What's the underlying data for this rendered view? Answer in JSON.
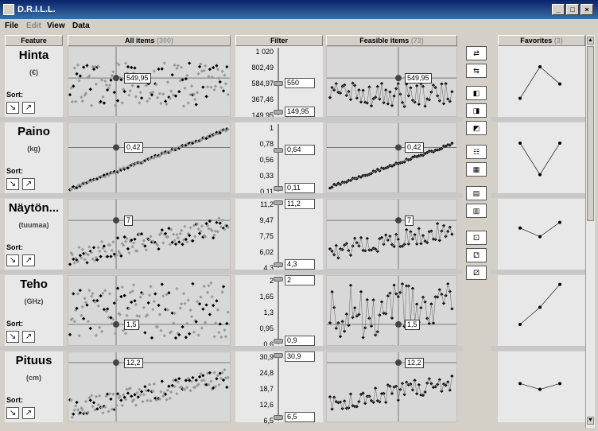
{
  "window": {
    "title": "D.R.I.L.L."
  },
  "menu": [
    "File",
    "Edit",
    "View",
    "Data"
  ],
  "headers": {
    "feature": "Feature",
    "all_items": "All items",
    "all_count": "(300)",
    "filter": "Filter",
    "feasible": "Feasible items",
    "feasible_count": "(73)",
    "favorites": "Favorites",
    "favorites_count": "(3)"
  },
  "sort_label": "Sort:",
  "features": [
    {
      "name": "Hinta",
      "unit": "(€)",
      "ticks": [
        "1 020",
        "802,49",
        "584,97",
        "367,46",
        "149,95"
      ],
      "upper": "550",
      "lower": "149,95",
      "value": "549,95",
      "fav": [
        0.2,
        0.75,
        0.45
      ]
    },
    {
      "name": "Paino",
      "unit": "(kg)",
      "ticks": [
        "1",
        "0,78",
        "0,56",
        "0,33",
        "0,11"
      ],
      "upper": "0,64",
      "lower": "0,11",
      "value": "0,42",
      "fav": [
        0.75,
        0.2,
        0.75
      ]
    },
    {
      "name": "Näytön...",
      "unit": "(tuumaa)",
      "ticks": [
        "11,2",
        "9,47",
        "7,75",
        "6,02",
        "4,3"
      ],
      "upper": "11,2",
      "lower": "4,3",
      "value": "7",
      "fav": [
        0.6,
        0.45,
        0.7
      ]
    },
    {
      "name": "Teho",
      "unit": "(GHz)",
      "ticks": [
        "2",
        "1,65",
        "1,3",
        "0,95",
        "0,6"
      ],
      "upper": "2",
      "lower": "0,9",
      "value": "1,5",
      "fav": [
        0.25,
        0.55,
        0.95
      ]
    },
    {
      "name": "Pituus",
      "unit": "(cm)",
      "ticks": [
        "30,9",
        "24,8",
        "18,7",
        "12,6",
        "6,5"
      ],
      "upper": "30,9",
      "lower": "6,5",
      "value": "12,2",
      "fav": [
        0.55,
        0.45,
        0.55
      ]
    }
  ],
  "icons": [
    "move-right-icon",
    "move-left-icon",
    "lock-move-icon",
    "lock-copy-icon",
    "lock-swap-icon",
    "numbered-list-icon",
    "grid-list-icon",
    "export-icon",
    "import-icon",
    "dice-icon",
    "dice-two-icon",
    "dice-three-icon"
  ]
}
